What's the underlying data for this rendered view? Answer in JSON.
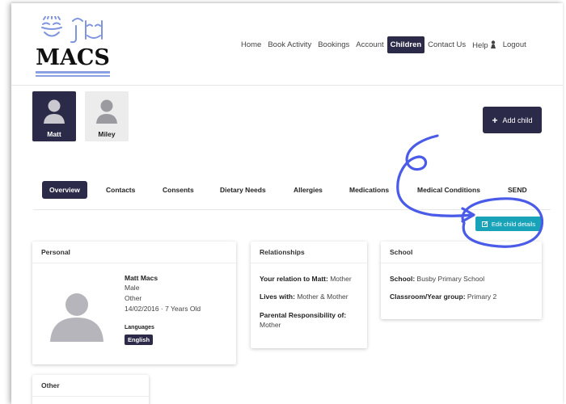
{
  "brand": {
    "name": "MACS"
  },
  "nav": [
    {
      "label": "Home"
    },
    {
      "label": "Book Activity"
    },
    {
      "label": "Bookings"
    },
    {
      "label": "Account"
    },
    {
      "label": "Children",
      "active": true
    },
    {
      "label": "Contact Us"
    },
    {
      "label": "Help"
    },
    {
      "label": "Logout"
    }
  ],
  "children": [
    {
      "name": "Matt",
      "active": true
    },
    {
      "name": "Miley",
      "active": false
    }
  ],
  "add_child_label": "Add child",
  "tabs": [
    {
      "label": "Overview",
      "active": true
    },
    {
      "label": "Contacts"
    },
    {
      "label": "Consents"
    },
    {
      "label": "Dietary Needs"
    },
    {
      "label": "Allergies"
    },
    {
      "label": "Medications"
    },
    {
      "label": "Medical Conditions"
    },
    {
      "label": "SEND"
    }
  ],
  "edit_button_label": "Edit child details",
  "personal": {
    "title": "Personal",
    "name": "Matt Macs",
    "gender": "Male",
    "other": "Other",
    "dob": "14/02/2016 · 7 Years Old",
    "languages_label": "Languages",
    "language": "English"
  },
  "relationships": {
    "title": "Relationships",
    "relation_label": "Your relation to Matt:",
    "relation_value": "Mother",
    "lives_with_label": "Lives with:",
    "lives_with_value": "Mother & Mother",
    "parental_label": "Parental Responsibility of:",
    "parental_value": "Mother"
  },
  "school": {
    "title": "School",
    "school_label": "School:",
    "school_value": "Busby Primary School",
    "year_label": "Classroom/Year group:",
    "year_value": "Primary 2"
  },
  "other": {
    "title": "Other"
  },
  "colors": {
    "primary": "#2b2a48",
    "accent": "#18a3b8",
    "annotation": "#4a5be8"
  }
}
